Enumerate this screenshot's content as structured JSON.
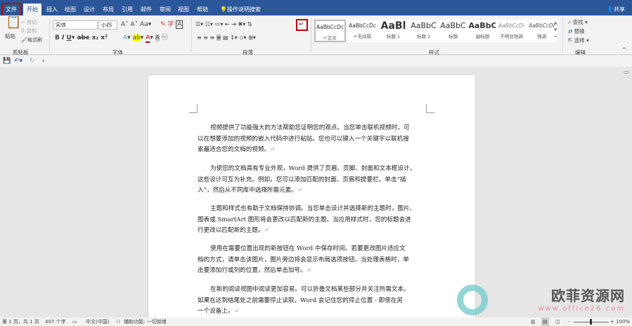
{
  "tabs": [
    "文件",
    "开始",
    "插入",
    "绘图",
    "设计",
    "布局",
    "引用",
    "邮件",
    "审阅",
    "视图",
    "帮助"
  ],
  "search_label": "操作说明搜索",
  "share_label": "共享",
  "clipboard": {
    "paste": "粘贴",
    "cut": "剪切",
    "copy": "复制",
    "format_painter": "格式刷",
    "label": "剪贴板"
  },
  "font": {
    "name": "宋体",
    "size": "小四",
    "label": "字体"
  },
  "paragraph": {
    "label": "段落"
  },
  "styles": {
    "label": "样式",
    "items": [
      {
        "preview": "AaBbCcDc",
        "name": "↵正文"
      },
      {
        "preview": "AaBbCcDc",
        "name": "↵无间隔"
      },
      {
        "preview": "AaBl",
        "name": "标题 1"
      },
      {
        "preview": "AaBbC",
        "name": "标题 2"
      },
      {
        "preview": "AaBbC",
        "name": "标题"
      },
      {
        "preview": "AaBbC",
        "name": "副标题"
      },
      {
        "preview": "AaBbCcDi",
        "name": "不明显强调"
      },
      {
        "preview": "AaBbCcDi",
        "name": "强调"
      }
    ]
  },
  "editing": {
    "find": "查找",
    "replace": "替换",
    "select": "选择",
    "label": "编辑"
  },
  "document": {
    "paragraphs": [
      [
        "视频提供了功能强大的方法帮助您证明您的观点。当您单击联机视频时，可",
        "以在想要添加的视频的嵌入代码中进行粘贴。您也可以键入一个关键字以联机搜",
        "索最适合您的文档的视频。"
      ],
      [
        "为使您的文档具有专业外观，Word 提供了页眉、页脚、封面和文本框设计，",
        "这些设计可互为补充。例如，您可以添加匹配的封面、页眉和提要栏。单击“插",
        "入”，然后从不同库中选择所需元素。"
      ],
      [
        "主题和样式也有助于文档保持协调。当您单击设计并选择新的主题时，图片、",
        "图表或 SmartArt 图形将会更改以匹配新的主题。当应用样式时，您的标题会进",
        "行更改以匹配新的主题。"
      ],
      [
        "使用在需要位置出现的新按钮在  Word  中保存时间。若要更改图片适应文",
        "档的方式，请单击该图片，图片旁边将会显示布局选项按钮。当处理表格时，单",
        "击要添加行或列的位置，然后单击加号。"
      ],
      [
        "在新的阅读视图中阅读更加容易。可以折叠文档某些部分并关注所需文本。",
        "如果在达到结尾处之前需要停止读取，Word  会记住您的停止位置 - 即使在另",
        "一个设备上。"
      ]
    ],
    "para_mark": "↵"
  },
  "status": {
    "page": "第 1 页，共 1 页",
    "words": "407 个字",
    "language": "中文(中国)",
    "accessibility": "辅助功能: 一切就绪",
    "zoom": "100%"
  },
  "watermark": {
    "name": "欧菲资源网",
    "url": "www.office26.com"
  },
  "colors": {
    "brand": "#2b579a",
    "highlight": "#c00000"
  }
}
